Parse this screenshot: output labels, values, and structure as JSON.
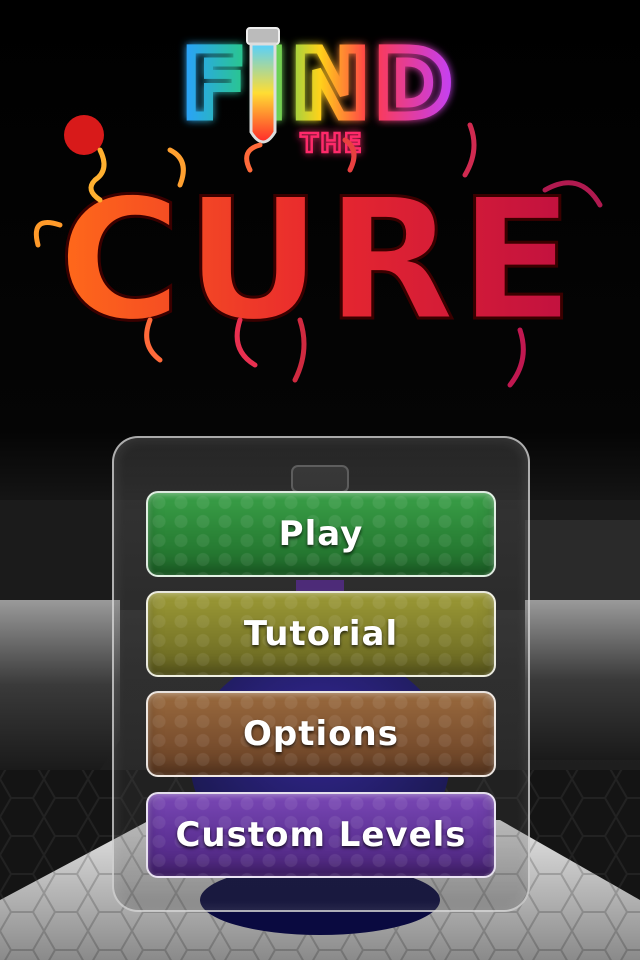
{
  "logo": {
    "find": "FIND",
    "the": "THE",
    "cure": "CURE"
  },
  "menu": {
    "buttons": [
      {
        "label": "Play",
        "color": "#2e8c3c"
      },
      {
        "label": "Tutorial",
        "color": "#8a8a2a"
      },
      {
        "label": "Options",
        "color": "#8a5a32"
      },
      {
        "label": "Custom Levels",
        "color": "#6a3aa2"
      }
    ]
  },
  "colors": {
    "background": "#000000",
    "cure_left": "#ff6a1a",
    "cure_right": "#c01040"
  }
}
